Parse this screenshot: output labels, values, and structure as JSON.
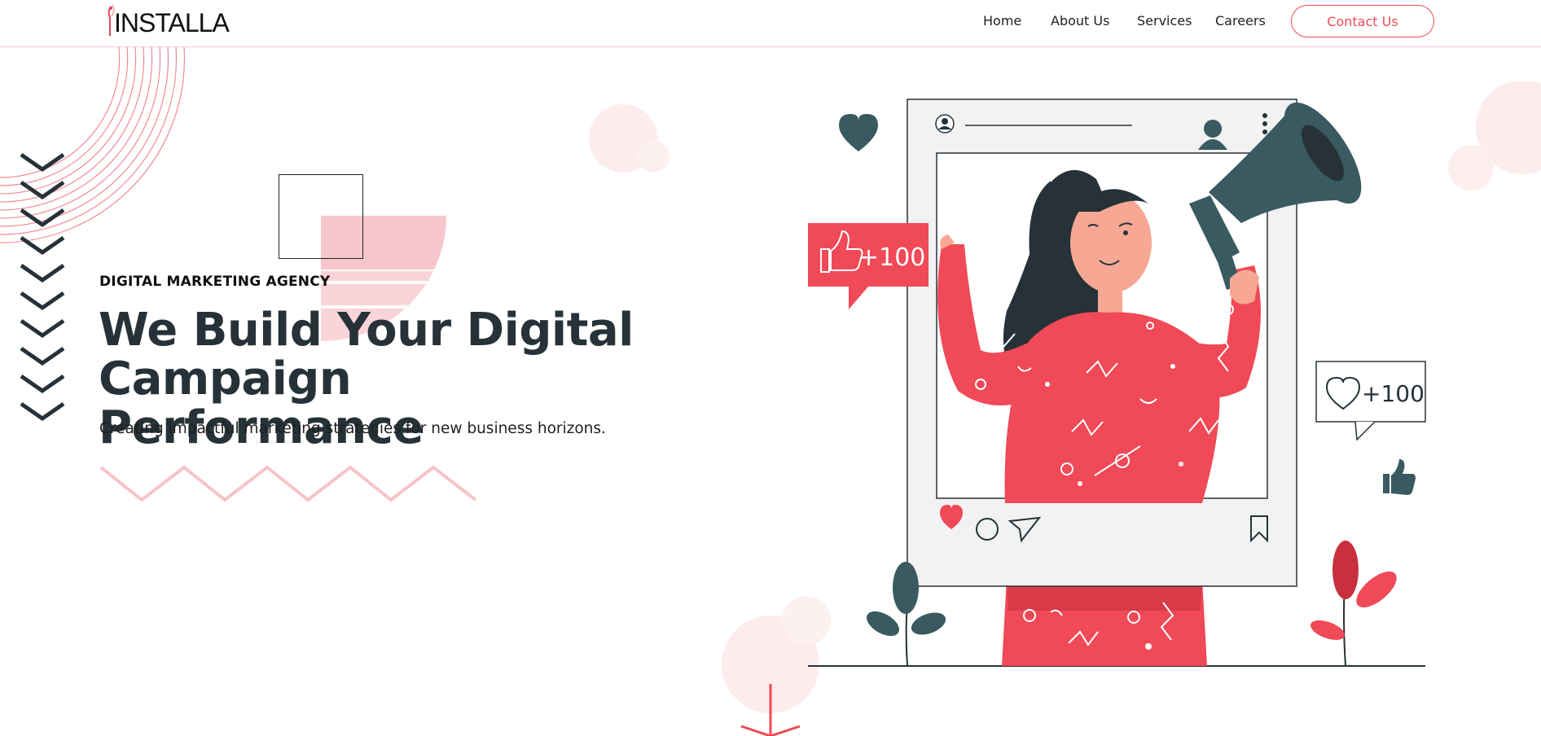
{
  "header": {
    "logo_text": "INSTALLA",
    "nav": [
      {
        "label": "Home"
      },
      {
        "label": "About Us"
      },
      {
        "label": "Services"
      },
      {
        "label": "Careers"
      }
    ],
    "contact_label": "Contact Us"
  },
  "hero": {
    "eyebrow": "DIGITAL MARKETING AGENCY",
    "headline_line1": "We Build Your Digital",
    "headline_line2": "Campaign Performance",
    "subtitle": "Creating impactful marketing strategies for new business horizons."
  },
  "illustration": {
    "like_badge": "+100",
    "heart_badge": "+100"
  },
  "colors": {
    "accent": "#f04957",
    "dark": "#263238",
    "soft_pink": "#f8c9ce"
  }
}
